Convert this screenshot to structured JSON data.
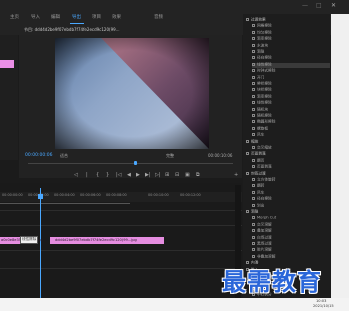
{
  "menubar": {
    "items": [
      "主页",
      "导入",
      "编辑",
      "导出",
      "项目",
      "效果",
      "音频"
    ],
    "active_index": 3,
    "min": "—",
    "max": "□",
    "close": "✕"
  },
  "program_monitor": {
    "title": "节目: ddd4d2be9f07ebdb7f74fe2ecd9c120(99...",
    "timecode_current": "00:00:00:06",
    "fit": "适合",
    "quality": "完整",
    "timecode_duration": "00:00:10:06",
    "transport": [
      "◁",
      "|",
      "{",
      "}",
      "|◁",
      "◀",
      "▶",
      "▶|",
      "▷|",
      "⊞",
      "⊟",
      "▣",
      "⧉",
      "+"
    ]
  },
  "effects_panel": {
    "rows": [
      {
        "label": "过渡效果",
        "type": "folder"
      },
      {
        "label": "网格擦除",
        "type": "item"
      },
      {
        "label": "均匀擦除",
        "type": "item"
      },
      {
        "label": "渐变擦除",
        "type": "item"
      },
      {
        "label": "水波块",
        "type": "item"
      },
      {
        "label": "渐隐",
        "type": "item"
      },
      {
        "label": "径向擦除",
        "type": "item"
      },
      {
        "label": "线性擦除",
        "type": "item",
        "selected": true
      },
      {
        "label": "时钟式擦除",
        "type": "item"
      },
      {
        "label": "开门",
        "type": "item"
      },
      {
        "label": "帶状擦除",
        "type": "item"
      },
      {
        "label": "块状擦除",
        "type": "item"
      },
      {
        "label": "渐变擦除",
        "type": "item"
      },
      {
        "label": "线性擦除",
        "type": "item"
      },
      {
        "label": "随机块",
        "type": "item"
      },
      {
        "label": "随机擦除",
        "type": "item"
      },
      {
        "label": "椭圆形擦除",
        "type": "item"
      },
      {
        "label": "螺旋框",
        "type": "item"
      },
      {
        "label": "风车",
        "type": "item"
      },
      {
        "label": "缩放",
        "type": "folder"
      },
      {
        "label": "交叉缩放",
        "type": "item"
      },
      {
        "label": "页面剥落",
        "type": "folder"
      },
      {
        "label": "翻页",
        "type": "item"
      },
      {
        "label": "页面剥落",
        "type": "item"
      },
      {
        "label": "封签过渡",
        "type": "folder"
      },
      {
        "label": "立方体旋转",
        "type": "item"
      },
      {
        "label": "翻转",
        "type": "item"
      },
      {
        "label": "风车",
        "type": "item"
      },
      {
        "label": "径向擦除",
        "type": "item"
      },
      {
        "label": "划出",
        "type": "item"
      },
      {
        "label": "渐隐",
        "type": "folder"
      },
      {
        "label": "Morph Cut",
        "type": "item"
      },
      {
        "label": "交叉溶解",
        "type": "item"
      },
      {
        "label": "叠加溶解",
        "type": "item"
      },
      {
        "label": "白场过渡",
        "type": "item"
      },
      {
        "label": "黑场过渡",
        "type": "item"
      },
      {
        "label": "胶片溶解",
        "type": "item"
      },
      {
        "label": "非叠加溶解",
        "type": "item"
      },
      {
        "label": "内滑",
        "type": "folder"
      },
      {
        "label": "推入",
        "type": "folder"
      },
      {
        "label": "带状滑动",
        "type": "item"
      },
      {
        "label": "拆分",
        "type": "item"
      },
      {
        "label": "推",
        "type": "item"
      },
      {
        "label": "中心拆分",
        "type": "item"
      }
    ]
  },
  "timeline": {
    "ruler": [
      "00:00:00:00",
      "00:00:02:00",
      "00:00:04:00",
      "00:00:06:00",
      "00:00:08:00",
      "00:00:10:00",
      "00:00:12:00"
    ],
    "clip1_label": "a0c0e8e35e5f0029.jpg",
    "transition_label": "线性擦除",
    "clip2_label": "ddd4d2be9f07ebdb7f74fe2ecd9c120(99...jpg"
  },
  "watermark": "最需教育",
  "taskbar": {
    "time": "10:03",
    "date": "2021/10/15"
  }
}
